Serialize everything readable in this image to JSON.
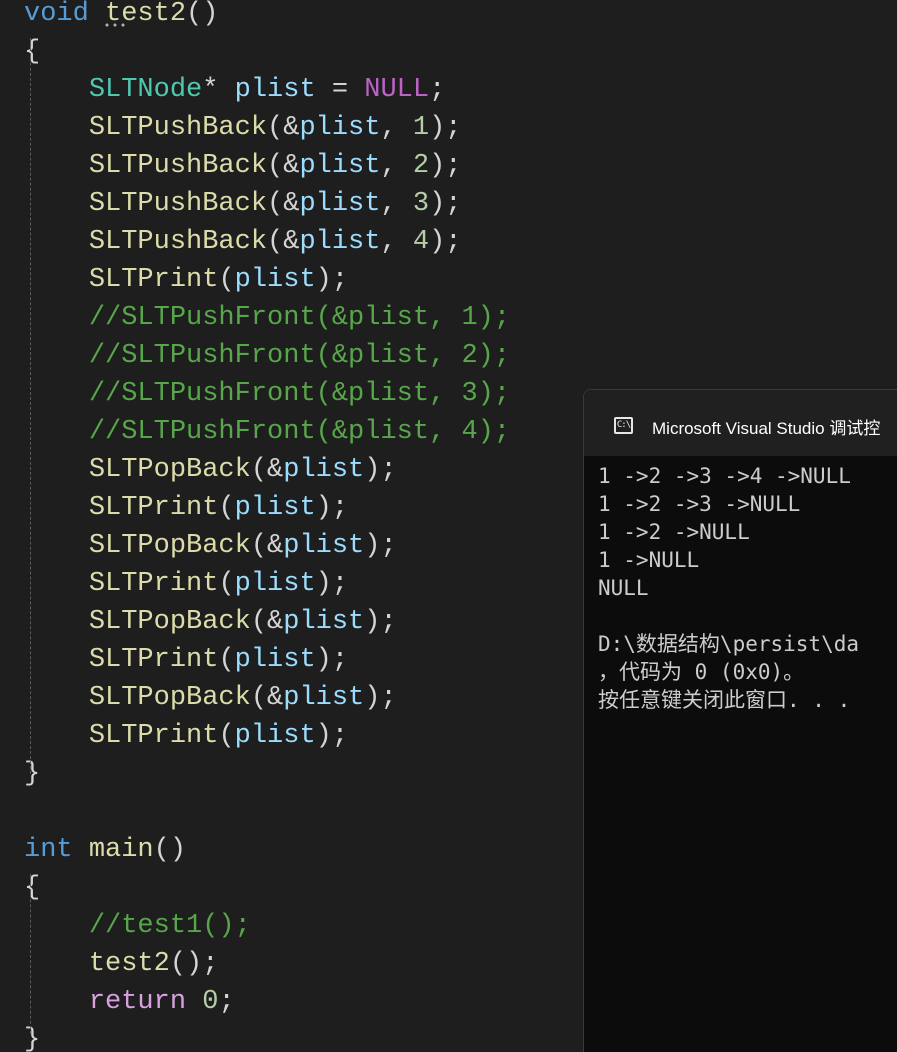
{
  "editor": {
    "lines": [
      [
        {
          "t": "void",
          "c": "kw"
        },
        {
          "t": " ",
          "c": "punc"
        },
        {
          "t": "test2",
          "c": "func"
        },
        {
          "t": "()",
          "c": "punc"
        }
      ],
      [
        {
          "t": "{",
          "c": "punc"
        }
      ],
      [
        {
          "t": "    ",
          "c": "punc"
        },
        {
          "t": "SLTNode",
          "c": "type"
        },
        {
          "t": "* ",
          "c": "punc"
        },
        {
          "t": "plist",
          "c": "var"
        },
        {
          "t": " = ",
          "c": "punc"
        },
        {
          "t": "NULL",
          "c": "macro"
        },
        {
          "t": ";",
          "c": "punc"
        }
      ],
      [
        {
          "t": "    ",
          "c": "punc"
        },
        {
          "t": "SLTPushBack",
          "c": "func"
        },
        {
          "t": "(&",
          "c": "punc"
        },
        {
          "t": "plist",
          "c": "var"
        },
        {
          "t": ", ",
          "c": "punc"
        },
        {
          "t": "1",
          "c": "num"
        },
        {
          "t": ");",
          "c": "punc"
        }
      ],
      [
        {
          "t": "    ",
          "c": "punc"
        },
        {
          "t": "SLTPushBack",
          "c": "func"
        },
        {
          "t": "(&",
          "c": "punc"
        },
        {
          "t": "plist",
          "c": "var"
        },
        {
          "t": ", ",
          "c": "punc"
        },
        {
          "t": "2",
          "c": "num"
        },
        {
          "t": ");",
          "c": "punc"
        }
      ],
      [
        {
          "t": "    ",
          "c": "punc"
        },
        {
          "t": "SLTPushBack",
          "c": "func"
        },
        {
          "t": "(&",
          "c": "punc"
        },
        {
          "t": "plist",
          "c": "var"
        },
        {
          "t": ", ",
          "c": "punc"
        },
        {
          "t": "3",
          "c": "num"
        },
        {
          "t": ");",
          "c": "punc"
        }
      ],
      [
        {
          "t": "    ",
          "c": "punc"
        },
        {
          "t": "SLTPushBack",
          "c": "func"
        },
        {
          "t": "(&",
          "c": "punc"
        },
        {
          "t": "plist",
          "c": "var"
        },
        {
          "t": ", ",
          "c": "punc"
        },
        {
          "t": "4",
          "c": "num"
        },
        {
          "t": ");",
          "c": "punc"
        }
      ],
      [
        {
          "t": "    ",
          "c": "punc"
        },
        {
          "t": "SLTPrint",
          "c": "func"
        },
        {
          "t": "(",
          "c": "punc"
        },
        {
          "t": "plist",
          "c": "var"
        },
        {
          "t": ");",
          "c": "punc"
        }
      ],
      [
        {
          "t": "    ",
          "c": "punc"
        },
        {
          "t": "//SLTPushFront(&plist, 1);",
          "c": "cmt"
        }
      ],
      [
        {
          "t": "    ",
          "c": "punc"
        },
        {
          "t": "//SLTPushFront(&plist, 2);",
          "c": "cmt"
        }
      ],
      [
        {
          "t": "    ",
          "c": "punc"
        },
        {
          "t": "//SLTPushFront(&plist, 3);",
          "c": "cmt"
        }
      ],
      [
        {
          "t": "    ",
          "c": "punc"
        },
        {
          "t": "//SLTPushFront(&plist, 4);",
          "c": "cmt"
        }
      ],
      [
        {
          "t": "    ",
          "c": "punc"
        },
        {
          "t": "SLTPopBack",
          "c": "func"
        },
        {
          "t": "(&",
          "c": "punc"
        },
        {
          "t": "plist",
          "c": "var"
        },
        {
          "t": ");",
          "c": "punc"
        }
      ],
      [
        {
          "t": "    ",
          "c": "punc"
        },
        {
          "t": "SLTPrint",
          "c": "func"
        },
        {
          "t": "(",
          "c": "punc"
        },
        {
          "t": "plist",
          "c": "var"
        },
        {
          "t": ");",
          "c": "punc"
        }
      ],
      [
        {
          "t": "    ",
          "c": "punc"
        },
        {
          "t": "SLTPopBack",
          "c": "func"
        },
        {
          "t": "(&",
          "c": "punc"
        },
        {
          "t": "plist",
          "c": "var"
        },
        {
          "t": ");",
          "c": "punc"
        }
      ],
      [
        {
          "t": "    ",
          "c": "punc"
        },
        {
          "t": "SLTPrint",
          "c": "func"
        },
        {
          "t": "(",
          "c": "punc"
        },
        {
          "t": "plist",
          "c": "var"
        },
        {
          "t": ");",
          "c": "punc"
        }
      ],
      [
        {
          "t": "    ",
          "c": "punc"
        },
        {
          "t": "SLTPopBack",
          "c": "func"
        },
        {
          "t": "(&",
          "c": "punc"
        },
        {
          "t": "plist",
          "c": "var"
        },
        {
          "t": ");",
          "c": "punc"
        }
      ],
      [
        {
          "t": "    ",
          "c": "punc"
        },
        {
          "t": "SLTPrint",
          "c": "func"
        },
        {
          "t": "(",
          "c": "punc"
        },
        {
          "t": "plist",
          "c": "var"
        },
        {
          "t": ");",
          "c": "punc"
        }
      ],
      [
        {
          "t": "    ",
          "c": "punc"
        },
        {
          "t": "SLTPopBack",
          "c": "func"
        },
        {
          "t": "(&",
          "c": "punc"
        },
        {
          "t": "plist",
          "c": "var"
        },
        {
          "t": ");",
          "c": "punc"
        }
      ],
      [
        {
          "t": "    ",
          "c": "punc"
        },
        {
          "t": "SLTPrint",
          "c": "func"
        },
        {
          "t": "(",
          "c": "punc"
        },
        {
          "t": "plist",
          "c": "var"
        },
        {
          "t": ");",
          "c": "punc"
        }
      ],
      [
        {
          "t": "}",
          "c": "punc"
        }
      ],
      [],
      [
        {
          "t": "int",
          "c": "kw"
        },
        {
          "t": " ",
          "c": "punc"
        },
        {
          "t": "main",
          "c": "func"
        },
        {
          "t": "()",
          "c": "punc"
        }
      ],
      [
        {
          "t": "{",
          "c": "punc"
        }
      ],
      [
        {
          "t": "    ",
          "c": "punc"
        },
        {
          "t": "//test1();",
          "c": "cmt"
        }
      ],
      [
        {
          "t": "    ",
          "c": "punc"
        },
        {
          "t": "test2",
          "c": "func"
        },
        {
          "t": "();",
          "c": "punc"
        }
      ],
      [
        {
          "t": "    ",
          "c": "punc"
        },
        {
          "t": "return",
          "c": "ctl"
        },
        {
          "t": " ",
          "c": "punc"
        },
        {
          "t": "0",
          "c": "num"
        },
        {
          "t": ";",
          "c": "punc"
        }
      ],
      [
        {
          "t": "}",
          "c": "punc"
        }
      ]
    ]
  },
  "console": {
    "icon": "console-app-icon",
    "icon_glyph": "C:\\",
    "title": "Microsoft Visual Studio 调试控",
    "output": [
      "1 ->2 ->3 ->4 ->NULL",
      "1 ->2 ->3 ->NULL",
      "1 ->2 ->NULL",
      "1 ->NULL",
      "NULL",
      "",
      "D:\\数据结构\\persist\\da",
      "，代码为 0 (0x0)。",
      "按任意键关闭此窗口. . ."
    ]
  },
  "colors": {
    "background": "#1e1e1e",
    "keyword": "#569cd6",
    "control": "#d8a0df",
    "type": "#4ec9b0",
    "function": "#dcdcaa",
    "variable": "#9cdcfe",
    "macro": "#bd63c5",
    "number": "#b5cea8",
    "comment": "#57a64a",
    "console_background": "#0c0c0c"
  }
}
